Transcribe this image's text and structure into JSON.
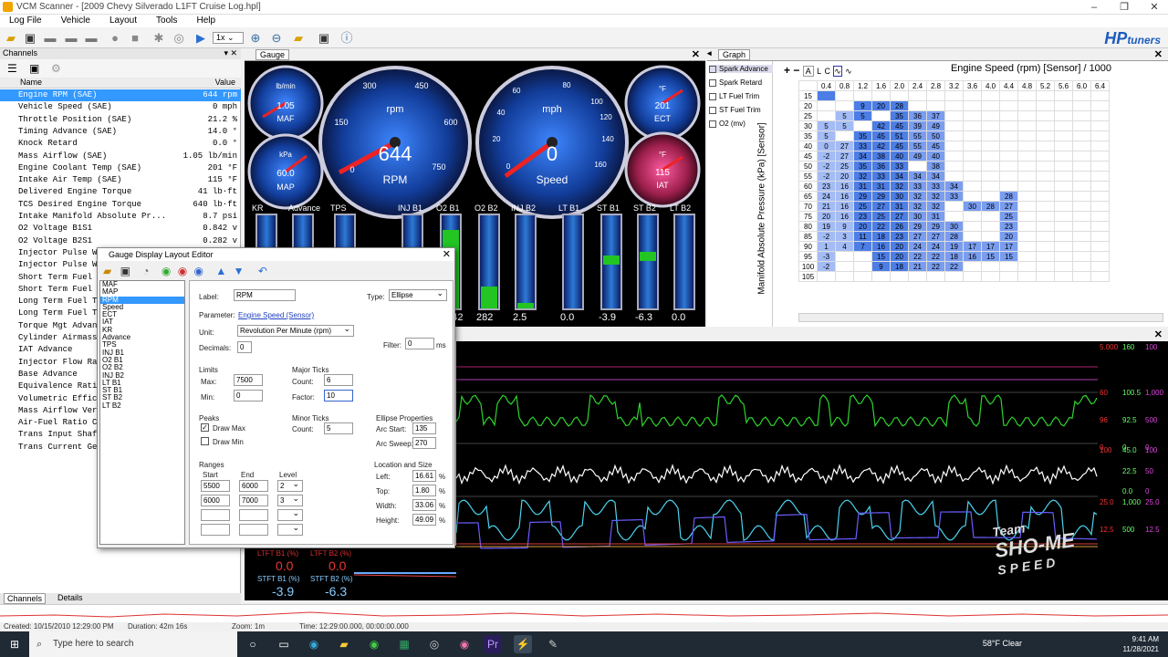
{
  "window": {
    "title": "VCM Scanner - [2009 Chevy Silverado L1FT Cruise Log.hpl]"
  },
  "menu": [
    "Log File",
    "Vehicle",
    "Layout",
    "Tools",
    "Help"
  ],
  "toolbar": {
    "playback_speed": "1x",
    "logo": "HP",
    "logo_suffix": "tuners"
  },
  "channels": {
    "panel_title": "Channels",
    "col_name": "Name",
    "col_value": "Value",
    "rows": [
      {
        "name": "Engine RPM (SAE)",
        "value": "644 rpm",
        "selected": true
      },
      {
        "name": "Vehicle Speed (SAE)",
        "value": "0 mph"
      },
      {
        "name": "Throttle Position (SAE)",
        "value": "21.2 %"
      },
      {
        "name": "Timing Advance (SAE)",
        "value": "14.0 °"
      },
      {
        "name": "Knock Retard",
        "value": "0.0 °"
      },
      {
        "name": "Mass Airflow (SAE)",
        "value": "1.05 lb/min"
      },
      {
        "name": "Engine Coolant Temp (SAE)",
        "value": "201 °F"
      },
      {
        "name": "Intake Air Temp (SAE)",
        "value": "115 °F"
      },
      {
        "name": "Delivered Engine Torque",
        "value": "41 lb·ft"
      },
      {
        "name": "TCS Desired Engine Torque",
        "value": "640 lb·ft"
      },
      {
        "name": "Intake Manifold Absolute Pr...",
        "value": "8.7 psi"
      },
      {
        "name": "O2 Voltage B1S1",
        "value": "0.842 v"
      },
      {
        "name": "O2 Voltage B2S1",
        "value": "0.282 v"
      },
      {
        "name": "Injector Pulse W",
        "value": ""
      },
      {
        "name": "Injector Pulse W",
        "value": ""
      },
      {
        "name": "Short Term Fuel",
        "value": ""
      },
      {
        "name": "Short Term Fuel",
        "value": ""
      },
      {
        "name": "Long Term Fuel T",
        "value": ""
      },
      {
        "name": "Long Term Fuel T",
        "value": ""
      },
      {
        "name": "Torque Mgt Advan",
        "value": ""
      },
      {
        "name": "Cylinder Airmass",
        "value": ""
      },
      {
        "name": "IAT Advance",
        "value": ""
      },
      {
        "name": "Injector Flow Ra",
        "value": ""
      },
      {
        "name": "Base Advance",
        "value": ""
      },
      {
        "name": "Equivalence Rati",
        "value": ""
      },
      {
        "name": "Volumetric Effic",
        "value": ""
      },
      {
        "name": "Mass Airflow Ver",
        "value": ""
      },
      {
        "name": "Air-Fuel Ratio C",
        "value": ""
      },
      {
        "name": "Trans Input Shaf",
        "value": ""
      },
      {
        "name": "Trans Current Ge",
        "value": ""
      }
    ],
    "tab_channels": "Channels",
    "tab_details": "Details"
  },
  "gauge": {
    "tab": "Gauge",
    "maf": {
      "unit": "lb/min",
      "value": "1.05",
      "label": "MAF"
    },
    "map": {
      "unit": "kPa",
      "value": "60.0",
      "label": "MAP"
    },
    "rpm": {
      "unit": "rpm",
      "value": "644",
      "label": "RPM",
      "ticks": [
        "0",
        "150",
        "300",
        "450",
        "600",
        "750"
      ]
    },
    "speed": {
      "unit": "mph",
      "value": "0",
      "label": "Speed",
      "ticks": [
        "0",
        "20",
        "40",
        "60",
        "80",
        "100",
        "120",
        "140",
        "160"
      ]
    },
    "ect": {
      "unit": "°F",
      "value": "201",
      "label": "ECT"
    },
    "iat": {
      "unit": "°F",
      "value": "115",
      "label": "IAT"
    },
    "bars": [
      {
        "label": "KR",
        "value": ""
      },
      {
        "label": "Advance",
        "value": ""
      },
      {
        "label": "TPS",
        "value": ""
      },
      {
        "label": "INJ B1",
        "value": ""
      },
      {
        "label": "O2 B1",
        "value": "0.842"
      },
      {
        "label": "O2 B2",
        "value": "282"
      },
      {
        "label": "INJ B2",
        "value": "2.5"
      },
      {
        "label": "LT B1",
        "value": "0.0"
      },
      {
        "label": "ST B1",
        "value": "-3.9"
      },
      {
        "label": "ST B2",
        "value": "-6.3"
      },
      {
        "label": "LT B2",
        "value": "0.0"
      }
    ]
  },
  "graph": {
    "tab": "Graph",
    "title": "Engine Speed (rpm) [Sensor] / 1000",
    "ylabel": "Manifold Absolute Pressure (kPa) [Sensor]",
    "legend": [
      "Spark Advance",
      "Spark Retard",
      "LT Fuel Trim",
      "ST Fuel Trim",
      "O2 (mv)"
    ],
    "cols": [
      "0.4",
      "0.8",
      "1.2",
      "1.6",
      "2.0",
      "2.4",
      "2.8",
      "3.2",
      "3.6",
      "4.0",
      "4.4",
      "4.8",
      "5.2",
      "5.6",
      "6.0",
      "6.4"
    ],
    "rows": [
      {
        "k": "15",
        "v": [
          "",
          "",
          "",
          "",
          "",
          "",
          "",
          "",
          "",
          "",
          "",
          "",
          "",
          "",
          "",
          ""
        ]
      },
      {
        "k": "20",
        "v": [
          "",
          "",
          "9",
          "20",
          "28",
          "",
          "",
          "",
          "",
          "",
          "",
          "",
          "",
          "",
          "",
          ""
        ]
      },
      {
        "k": "25",
        "v": [
          "",
          "5",
          "5",
          "",
          "35",
          "36",
          "37",
          "",
          "",
          "",
          "",
          "",
          "",
          "",
          "",
          ""
        ]
      },
      {
        "k": "30",
        "v": [
          "5",
          "5",
          "",
          "42",
          "45",
          "39",
          "49",
          "",
          "",
          "",
          "",
          "",
          "",
          "",
          "",
          ""
        ]
      },
      {
        "k": "35",
        "v": [
          "5",
          "",
          "35",
          "45",
          "51",
          "55",
          "50",
          "",
          "",
          "",
          "",
          "",
          "",
          "",
          "",
          ""
        ]
      },
      {
        "k": "40",
        "v": [
          "0",
          "27",
          "33",
          "42",
          "45",
          "55",
          "45",
          "",
          "",
          "",
          "",
          "",
          "",
          "",
          "",
          ""
        ]
      },
      {
        "k": "45",
        "v": [
          "-2",
          "27",
          "34",
          "38",
          "40",
          "49",
          "40",
          "",
          "",
          "",
          "",
          "",
          "",
          "",
          "",
          ""
        ]
      },
      {
        "k": "50",
        "v": [
          "-2",
          "25",
          "35",
          "36",
          "33",
          "",
          "38",
          "",
          "",
          "",
          "",
          "",
          "",
          "",
          "",
          ""
        ]
      },
      {
        "k": "55",
        "v": [
          "-2",
          "20",
          "32",
          "33",
          "34",
          "34",
          "34",
          "",
          "",
          "",
          "",
          "",
          "",
          "",
          "",
          ""
        ]
      },
      {
        "k": "60",
        "v": [
          "23",
          "16",
          "31",
          "31",
          "32",
          "33",
          "33",
          "34",
          "",
          "",
          "",
          "",
          "",
          "",
          "",
          ""
        ]
      },
      {
        "k": "65",
        "v": [
          "24",
          "16",
          "29",
          "29",
          "30",
          "32",
          "32",
          "33",
          "",
          "",
          "28",
          "",
          "",
          "",
          "",
          ""
        ]
      },
      {
        "k": "70",
        "v": [
          "21",
          "16",
          "25",
          "27",
          "31",
          "32",
          "32",
          "",
          "30",
          "28",
          "27",
          "",
          "",
          "",
          "",
          ""
        ]
      },
      {
        "k": "75",
        "v": [
          "20",
          "16",
          "23",
          "25",
          "27",
          "30",
          "31",
          "",
          "",
          "",
          "25",
          "",
          "",
          "",
          "",
          ""
        ]
      },
      {
        "k": "80",
        "v": [
          "19",
          "9",
          "20",
          "22",
          "26",
          "29",
          "29",
          "30",
          "",
          "",
          "23",
          "",
          "",
          "",
          "",
          ""
        ]
      },
      {
        "k": "85",
        "v": [
          "-2",
          "3",
          "11",
          "18",
          "23",
          "27",
          "27",
          "28",
          "",
          "",
          "20",
          "",
          "",
          "",
          "",
          ""
        ]
      },
      {
        "k": "90",
        "v": [
          "1",
          "4",
          "7",
          "16",
          "20",
          "24",
          "24",
          "19",
          "17",
          "17",
          "17",
          "",
          "",
          "",
          "",
          ""
        ]
      },
      {
        "k": "95",
        "v": [
          "-3",
          "",
          "",
          "15",
          "20",
          "22",
          "22",
          "18",
          "16",
          "15",
          "15",
          "",
          "",
          "",
          "",
          ""
        ]
      },
      {
        "k": "100",
        "v": [
          "-2",
          "",
          "",
          "9",
          "18",
          "21",
          "22",
          "22",
          "",
          "",
          "",
          "",
          "",
          "",
          "",
          ""
        ]
      },
      {
        "k": "105",
        "v": [
          "",
          "",
          "",
          "",
          "",
          "",
          "",
          "",
          "",
          "",
          "",
          "",
          "",
          "",
          "",
          ""
        ]
      }
    ]
  },
  "charts": {
    "readouts": [
      {
        "a": "5.000",
        "b": "160",
        "c": "100"
      },
      {
        "a": "60",
        "b": "100.5",
        "c": "1,000"
      },
      {
        "a": "96",
        "b": "92.5",
        "c": "500"
      },
      {
        "a": "0",
        "b": "0",
        "c": "0"
      },
      {
        "a": "100",
        "b": "45.0",
        "c": "100"
      },
      {
        "a": "",
        "b": "22.5",
        "c": "50"
      },
      {
        "a": "",
        "b": "0.0",
        "c": "0"
      },
      {
        "a": "25.0",
        "b": "1,000",
        "c": "25.0"
      },
      {
        "a": "12.5",
        "b": "500",
        "c": "12.5"
      }
    ],
    "low": [
      {
        "label": "LTFT B1 (%)",
        "value": "0.0"
      },
      {
        "label": "LTFT B2 (%)",
        "value": "0.0"
      },
      {
        "label": "STFT B1 (%)",
        "value": "-3.9"
      },
      {
        "label": "STFT B2 (%)",
        "value": "-6.3"
      }
    ]
  },
  "dialog": {
    "title": "Gauge Display Layout Editor",
    "list": [
      "MAF",
      "MAP",
      "RPM",
      "Speed",
      "ECT",
      "IAT",
      "KR",
      "Advance",
      "TPS",
      "INJ B1",
      "O2 B1",
      "O2 B2",
      "INJ B2",
      "LT B1",
      "ST B1",
      "ST B2",
      "LT B2"
    ],
    "selected": "RPM",
    "label_l": "Label:",
    "label_v": "RPM",
    "type_l": "Type:",
    "type_v": "Ellipse",
    "param_l": "Parameter:",
    "param_v": "Engine Speed (Sensor)",
    "unit_l": "Unit:",
    "unit_v": "Revolution Per Minute (rpm)",
    "dec_l": "Decimals:",
    "dec_v": "0",
    "filter_l": "Filter:",
    "filter_v": "0",
    "filter_u": "ms",
    "limits": "Limits",
    "max_l": "Max:",
    "max_v": "7500",
    "min_l": "Min:",
    "min_v": "0",
    "major": "Major Ticks",
    "count_l": "Count:",
    "count_v": "6",
    "factor_l": "Factor:",
    "factor_v": "10",
    "peaks": "Peaks",
    "drawmax": "Draw Max",
    "drawmin": "Draw Min",
    "minor": "Minor Ticks",
    "mcount_l": "Count:",
    "mcount_v": "5",
    "ellipse": "Ellipse Properties",
    "arcstart_l": "Arc Start:",
    "arcstart_v": "135",
    "arcsweep_l": "Arc Sweep:",
    "arcsweep_v": "270",
    "ranges": "Ranges",
    "start": "Start",
    "end": "End",
    "level": "Level",
    "r1": {
      "s": "5500",
      "e": "6000",
      "l": "2"
    },
    "r2": {
      "s": "6000",
      "e": "7000",
      "l": "3"
    },
    "loc": "Location and Size",
    "left_l": "Left:",
    "left_v": "16.61",
    "top_l": "Top:",
    "top_v": "1.80",
    "width_l": "Width:",
    "width_v": "33.06",
    "height_l": "Height:",
    "height_v": "49.09",
    "pct": "%"
  },
  "status": {
    "created": "Created: 10/15/2010 12:29:00 PM",
    "duration": "Duration: 42m 16s",
    "zoom": "Zoom: 1m",
    "time": "Time: 12:29:00.000, 00:00:00.000"
  },
  "taskbar": {
    "search": "Type here to search",
    "weather": "58°F  Clear",
    "time": "9:41 AM",
    "date": "11/28/2021"
  },
  "watermark": {
    "line1": "Team",
    "line2": "SHO-ME",
    "line3": "SPEED"
  }
}
